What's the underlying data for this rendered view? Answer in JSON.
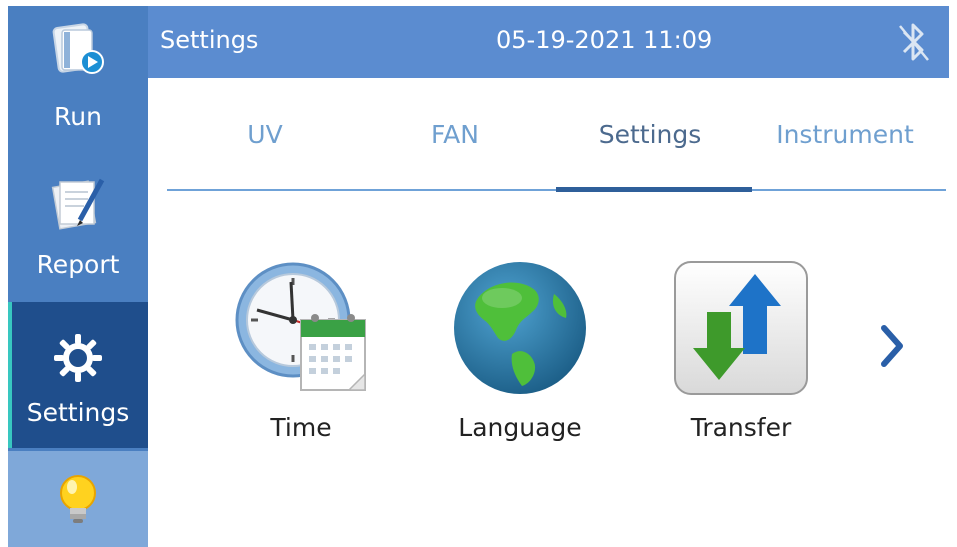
{
  "sidebar": {
    "items": [
      {
        "label": "Run",
        "icon": "run-book-icon"
      },
      {
        "label": "Report",
        "icon": "report-pen-icon"
      },
      {
        "label": "Settings",
        "icon": "gear-icon"
      },
      {
        "label": "",
        "icon": "lightbulb-icon"
      }
    ]
  },
  "header": {
    "title": "Settings",
    "datetime": "05-19-2021 11:09",
    "bluetooth_icon": "bluetooth-icon"
  },
  "tabs": [
    {
      "label": "UV"
    },
    {
      "label": "FAN"
    },
    {
      "label": "Settings",
      "active": true
    },
    {
      "label": "Instrument"
    }
  ],
  "tiles": [
    {
      "label": "Time",
      "icon": "clock-calendar-icon"
    },
    {
      "label": "Language",
      "icon": "globe-icon"
    },
    {
      "label": "Transfer",
      "icon": "transfer-arrows-icon"
    }
  ],
  "next_icon": "chevron-right-icon",
  "colors": {
    "sidebar": "#4a7fc1",
    "sidebar_active": "#1f4e8c",
    "header": "#5b8cd0",
    "tab_inactive": "#6f9fcf",
    "tab_active": "#4c6a8e",
    "accent": "#2f5f9a"
  }
}
